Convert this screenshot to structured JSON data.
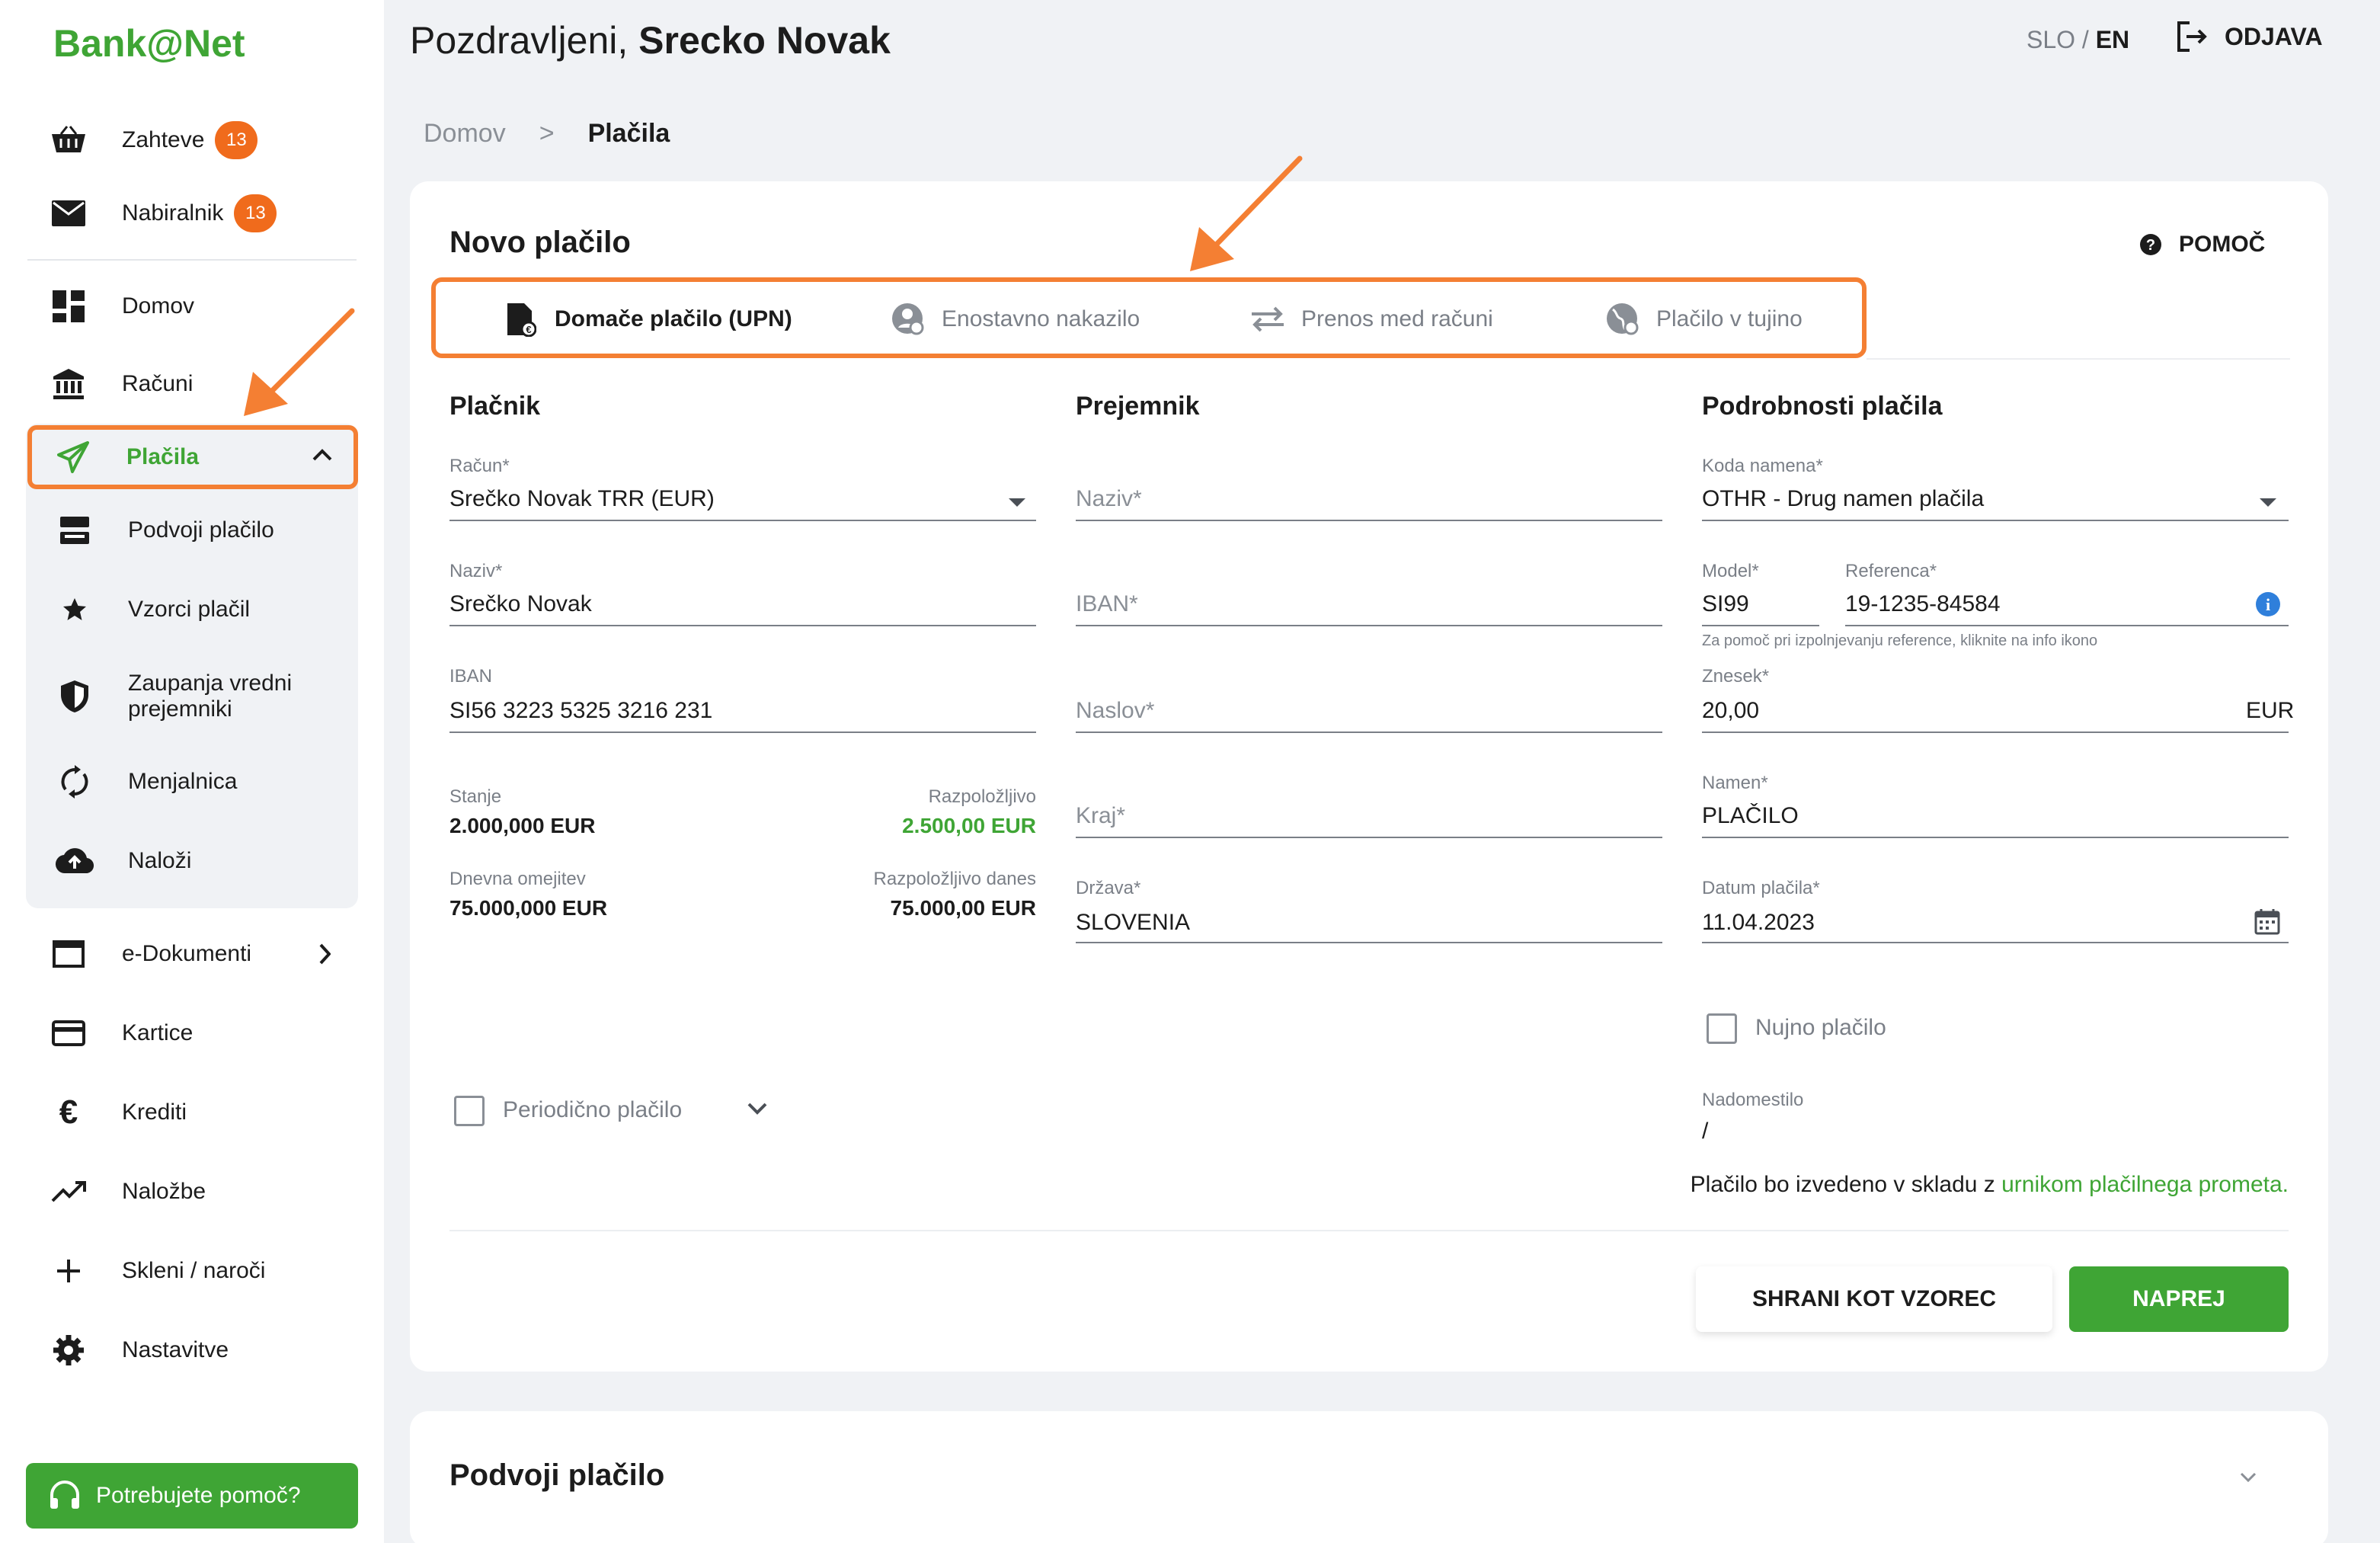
{
  "app": {
    "logo": "Bank@Net"
  },
  "header": {
    "greeting_prefix": "Pozdravljeni, ",
    "user_name": "Srecko Novak",
    "lang_slo": "SLO",
    "lang_sep": " / ",
    "lang_en": "EN",
    "logout_label": "ODJAVA"
  },
  "sidebar": {
    "zahteve": {
      "label": "Zahteve",
      "badge": "13"
    },
    "nabiralnik": {
      "label": "Nabiralnik",
      "badge": "13"
    },
    "domov": "Domov",
    "racuni": "Računi",
    "placila": "Plačila",
    "sub": {
      "podvoji": "Podvoji plačilo",
      "vzorci": "Vzorci plačil",
      "zaupanja": "Zaupanja vredni prejemniki",
      "menjalnica": "Menjalnica",
      "nalozi": "Naloži"
    },
    "edokumenti": "e-Dokumenti",
    "kartice": "Kartice",
    "krediti": "Krediti",
    "nalozbe": "Naložbe",
    "skleni": "Skleni / naroči",
    "nastavitve": "Nastavitve",
    "help": "Potrebujete pomoč?"
  },
  "breadcrumb": {
    "home": "Domov",
    "sep": ">",
    "current": "Plačila"
  },
  "card": {
    "title": "Novo plačilo",
    "help": "POMOČ",
    "tabs": [
      {
        "label": "Domače plačilo (UPN)"
      },
      {
        "label": "Enostavno nakazilo"
      },
      {
        "label": "Prenos med računi"
      },
      {
        "label": "Plačilo v tujino"
      }
    ]
  },
  "payer": {
    "title": "Plačnik",
    "account_label": "Račun*",
    "account_value": "Srečko Novak TRR (EUR)",
    "name_label": "Naziv*",
    "name_value": "Srečko Novak",
    "iban_label": "IBAN",
    "iban_value": "SI56 3223 5325 3216 231",
    "balance_label": "Stanje",
    "balance_value": "2.000,000 EUR",
    "available_label": "Razpoložljivo",
    "available_value": "2.500,00 EUR",
    "daily_limit_label": "Dnevna omejitev",
    "daily_limit_value": "75.000,000 EUR",
    "available_today_label": "Razpoložljivo danes",
    "available_today_value": "75.000,00 EUR",
    "periodic_label": "Periodično plačilo"
  },
  "recipient": {
    "title": "Prejemnik",
    "name_placeholder": "Naziv*",
    "iban_placeholder": "IBAN*",
    "address_placeholder": "Naslov*",
    "city_placeholder": "Kraj*",
    "country_label": "Država*",
    "country_value": "SLOVENIA"
  },
  "details": {
    "title": "Podrobnosti plačila",
    "purpose_code_label": "Koda namena*",
    "purpose_code_value": "OTHR - Drug namen plačila",
    "model_label": "Model*",
    "model_value": "SI99",
    "reference_label": "Referenca*",
    "reference_value": "19-1235-84584",
    "reference_note": "Za pomoč pri izpolnjevanju reference, kliknite na info ikono",
    "amount_label": "Znesek*",
    "amount_value": "20,00",
    "currency": "EUR",
    "purpose_label": "Namen*",
    "purpose_value": "PLAČILO",
    "date_label": "Datum plačila*",
    "date_value": "11.04.2023",
    "urgent_label": "Nujno plačilo",
    "fee_label": "Nadomestilo",
    "fee_value": "/",
    "notice_text": "Plačilo bo izvedeno v skladu z ",
    "notice_link": "urnikom plačilnega prometa."
  },
  "actions": {
    "save_template": "SHRANI KOT VZOREC",
    "next": "NAPREJ"
  },
  "duplicate_section": {
    "title": "Podvoji plačilo"
  },
  "colors": {
    "brand_green": "#3fa535",
    "badge_orange": "#f06b1c",
    "highlight_orange": "#f47f33"
  }
}
